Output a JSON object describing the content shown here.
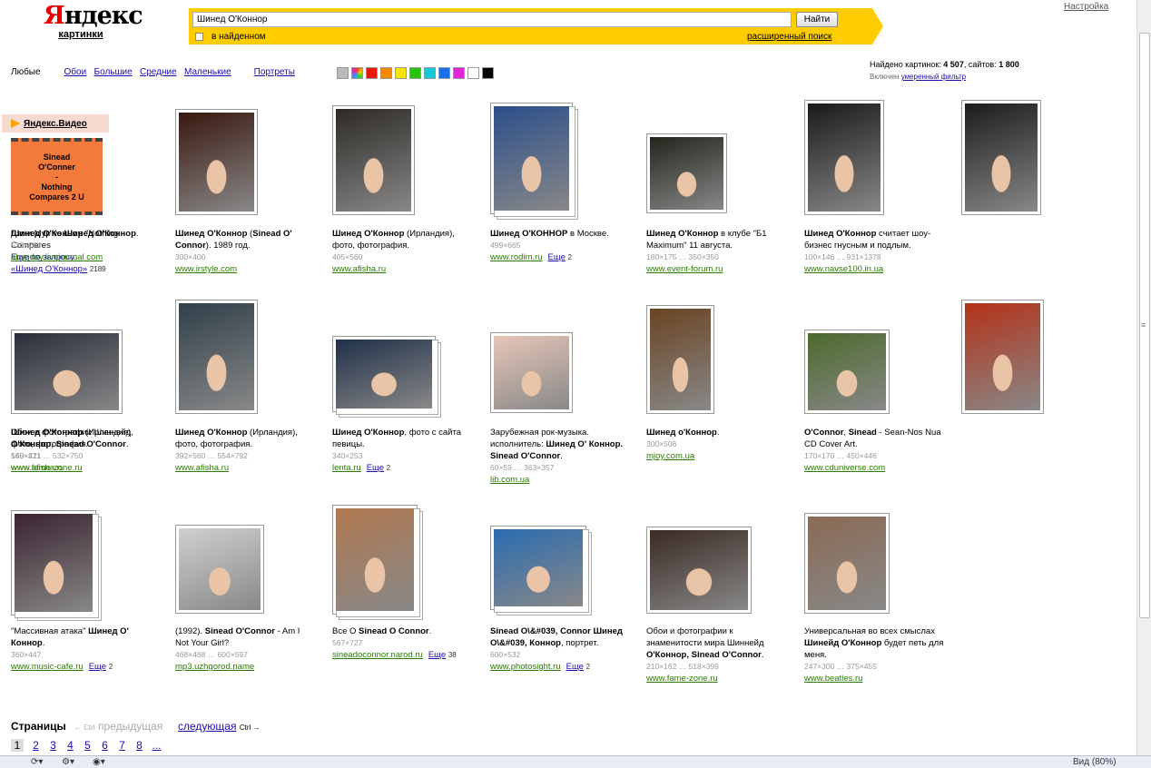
{
  "header": {
    "logo_first": "Я",
    "logo_rest": "ндекс",
    "logo_sub": "картинки",
    "settings": "Настройка"
  },
  "search": {
    "value": "Шинед О'Коннор",
    "button": "Найти",
    "in_found": "в найденном",
    "advanced": "расширенный поиск"
  },
  "filters": {
    "any": "Любые",
    "items": [
      "Обои",
      "Большие",
      "Средние",
      "Маленькие"
    ],
    "portraits": "Портреты",
    "colors": [
      "#bbbbbb",
      "#multi",
      "#e8180c",
      "#f28a00",
      "#f6e600",
      "#25c30c",
      "#18c6d6",
      "#1a6ee8",
      "#e026d6",
      "#ffffff",
      "#000000"
    ]
  },
  "stats": {
    "found_label": "Найдено картинок:",
    "images": "4 507",
    "sites_label": "сайтов:",
    "sites": "1 800",
    "filter_prefix": "Включен",
    "filter_link": "умеренный фильтр"
  },
  "video": {
    "head": "Яндекс.Видео",
    "thumb_lines": [
      "Sinead",
      "O'Conner",
      "-",
      "Nothing",
      "Compares 2 U"
    ],
    "title_bold": "Шинед О'Коннор",
    "title_rest": " \"Nothing Compares",
    "more_label": "Еще по запросу:",
    "more_query": "«Шинед О'Коннор»",
    "more_count": "2189"
  },
  "results": [
    {
      "pre": "",
      "bold": "Шинед О'Коннор",
      "post": " (",
      "bold2": "Sinead O' Connor",
      "post2": "). 1989 год.",
      "dims": "300×400",
      "site": "www.irstyle.com",
      "more": "",
      "cnt": ""
    },
    {
      "pre": "",
      "bold": "Шинед О'Коннор",
      "post": " (Ирландия), фото, фотография.",
      "bold2": "",
      "post2": "",
      "dims": "405×560",
      "site": "www.afisha.ru",
      "more": "",
      "cnt": ""
    },
    {
      "pre": "",
      "bold": "Шинед О'КОННОР",
      "post": " в Москве.",
      "bold2": "",
      "post2": "",
      "dims": "499×665",
      "site": "www.rodim.ru",
      "more": "Еще",
      "cnt": "2"
    },
    {
      "pre": "",
      "bold": "Шинед О'Коннор",
      "post": " в клубе \"Б1 Maximum\" 11 августа.",
      "bold2": "",
      "post2": "",
      "dims": "180×175 … 350×350",
      "site": "www.event-forum.ru",
      "more": "",
      "cnt": ""
    },
    {
      "pre": "",
      "bold": "Шинед О'Коннор",
      "post": " считает шоу-бизнес гнусным и подлым.",
      "bold2": "",
      "post2": "",
      "dims": "100×146 … 931×1378",
      "site": "www.navse100.in.ua",
      "more": "",
      "cnt": ""
    },
    {
      "pre": "Дэми Мур vs ",
      "bold": "Шинед О'Коннор",
      "post": ".",
      "bold2": "",
      "post2": "",
      "dims": "530×784",
      "site": "abygday.livejournal.com",
      "more": "",
      "cnt": ""
    },
    {
      "pre": "",
      "bold": "Шинед О'Коннор",
      "post": " (Ирландия), фото, фотография.",
      "bold2": "",
      "post2": "",
      "dims": "560×421",
      "site": "www.afisha.ru",
      "more": "",
      "cnt": ""
    },
    {
      "pre": "",
      "bold": "Шинед О'Коннор",
      "post": " (Ирландия), фото, фотография.",
      "bold2": "",
      "post2": "",
      "dims": "392×560 … 554×792",
      "site": "www.afisha.ru",
      "more": "",
      "cnt": ""
    },
    {
      "pre": "",
      "bold": "Шинед О'Коннор",
      "post": ", фото с сайта певицы.",
      "bold2": "",
      "post2": "",
      "dims": "340×253",
      "site": "lenta.ru",
      "more": "Еще",
      "cnt": "2"
    },
    {
      "pre": "Зарубежная рок-музыка. исполнитель: ",
      "bold": "Шинед О' Коннор. Sinead O'Connor",
      "post": ".",
      "bold2": "",
      "post2": "",
      "dims": "60×59 … 363×357",
      "site": "lib.com.ua",
      "more": "",
      "cnt": ""
    },
    {
      "pre": "",
      "bold": "Шинед о'Коннор",
      "post": ".",
      "bold2": "",
      "post2": "",
      "dims": "300×506",
      "site": "mjoy.com.ua",
      "more": "",
      "cnt": ""
    },
    {
      "pre": "",
      "bold": "O'Connor",
      "post": ", ",
      "bold2": "Sinead",
      "post2": " - Sean-Nos Nua CD Cover Art.",
      "dims": "170×170 … 450×446",
      "site": "www.cduniverse.com",
      "more": "",
      "cnt": ""
    },
    {
      "pre": "Обои и фотографии Шиннейд ",
      "bold": "O'Коннор, Sinead O'Connor",
      "post": ".",
      "bold2": "",
      "post2": "",
      "dims": "149×211 … 532×750",
      "site": "www.fame-zone.ru",
      "more": "",
      "cnt": ""
    },
    {
      "pre": "\"Массивная атака\" ",
      "bold": "Шинед О' Коннор",
      "post": ".",
      "bold2": "",
      "post2": "",
      "dims": "360×447",
      "site": "www.music-cafe.ru",
      "more": "Еще",
      "cnt": "2"
    },
    {
      "pre": "(1992). ",
      "bold": "Sinead O'Connor",
      "post": " - Am I Not Your Girl?",
      "bold2": "",
      "post2": "",
      "dims": "468×468 … 600×597",
      "site": "mp3.uzhgorod.name",
      "more": "",
      "cnt": ""
    },
    {
      "pre": "Все О ",
      "bold": "Sinead O Connor",
      "post": ".",
      "bold2": "",
      "post2": "",
      "dims": "567×727",
      "site": "sineadoconnor.narod.ru",
      "more": "Еще",
      "cnt": "38"
    },
    {
      "pre": "",
      "bold": "Sinead O\\&#039, Connor Шинед О\\&#039, Коннор",
      "post": ", портрет.",
      "bold2": "",
      "post2": "",
      "dims": "600×532",
      "site": "www.photosight.ru",
      "more": "Еще",
      "cnt": "2"
    },
    {
      "pre": "Обои и фотографии к знаменитости мира Шиннейд ",
      "bold": "O'Коннор, Sinead O'Connor",
      "post": ".",
      "bold2": "",
      "post2": "",
      "dims": "210×162 … 518×399",
      "site": "www.fame-zone.ru",
      "more": "",
      "cnt": ""
    },
    {
      "pre": "Универсальная во всех смыслах ",
      "bold": "Шинейд О'Коннор",
      "post": " будет петь для меня.",
      "bold2": "",
      "post2": "",
      "dims": "247×300 … 375×455",
      "site": "www.beatles.ru",
      "more": "",
      "cnt": ""
    }
  ],
  "pager": {
    "title": "Страницы",
    "prev_arrow": "← Ctrl",
    "prev": "предыдущая",
    "next": "следующая",
    "next_arrow": "Ctrl →",
    "pages": [
      "1",
      "2",
      "3",
      "4",
      "5",
      "6",
      "7",
      "8",
      "..."
    ]
  },
  "statusbar": {
    "zoom": "Вид (80%)"
  }
}
